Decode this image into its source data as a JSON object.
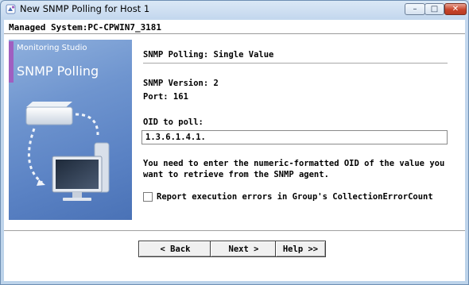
{
  "window": {
    "title": "New SNMP Polling for Host 1",
    "controls": {
      "minimize": "–",
      "maximize": "□",
      "close": "✕"
    }
  },
  "header": {
    "managed_system": "Managed System:PC-CPWIN7_3181"
  },
  "side_panel": {
    "brand": "Monitoring Studio",
    "product": "SNMP Polling"
  },
  "main": {
    "heading": "SNMP Polling: Single Value",
    "snmp_version": "SNMP Version: 2",
    "port": "Port: 161",
    "oid_label": "OID to poll:",
    "oid_value": "1.3.6.1.4.1.",
    "help_text": "You need to enter the numeric-formatted OID of the value you want to retrieve from the SNMP agent.",
    "checkbox": {
      "label": "Report execution errors in Group's CollectionErrorCount",
      "checked": false
    }
  },
  "buttons": {
    "back": "< Back",
    "next": "Next >",
    "help": "Help >>"
  },
  "colors": {
    "panel_blue": "#5a82c4",
    "panel_accent": "#a05fc0",
    "titlebar": "#c4d8ee",
    "close_button": "#c8452b"
  }
}
